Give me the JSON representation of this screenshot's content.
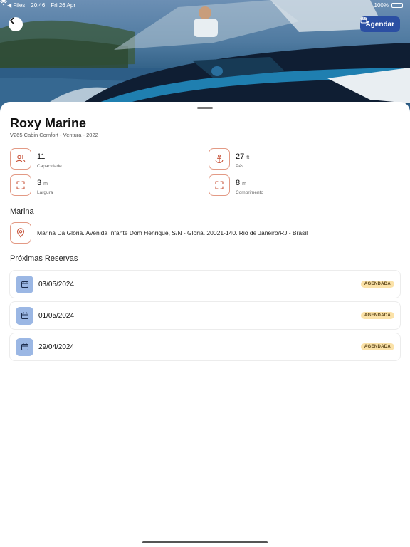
{
  "status_bar": {
    "back_app": "◀ Files",
    "time": "20:46",
    "date": "Fri 26 Apr",
    "battery": "100%"
  },
  "header": {
    "book_label": "Agendar"
  },
  "boat": {
    "name": "Roxy Marine",
    "subtitle": "V265 Cabin Comfort - Ventura - 2022"
  },
  "specs": [
    {
      "value": "11",
      "unit": "",
      "label": "Capacidade",
      "icon": "people-icon"
    },
    {
      "value": "27",
      "unit": "ft",
      "label": "Pés",
      "icon": "anchor-icon"
    },
    {
      "value": "3",
      "unit": "m",
      "label": "Largura",
      "icon": "expand-icon"
    },
    {
      "value": "8",
      "unit": "m",
      "label": "Comprimento",
      "icon": "expand-icon"
    }
  ],
  "marina": {
    "section_title": "Marina",
    "address": "Marina Da Gloria. Avenida Infante Dom Henrique, S/N - Glória. 20021-140. Rio de Janeiro/RJ - Brasil"
  },
  "reservations": {
    "section_title": "Próximas Reservas",
    "items": [
      {
        "date": "03/05/2024",
        "status": "AGENDADA"
      },
      {
        "date": "01/05/2024",
        "status": "AGENDADA"
      },
      {
        "date": "29/04/2024",
        "status": "AGENDADA"
      }
    ]
  },
  "colors": {
    "accent": "#2b4fa3",
    "icon_border": "#e39a85",
    "icon_stroke": "#c8573e",
    "calendar_bg": "#9bb7e4",
    "badge_bg": "#fbe2a8"
  }
}
